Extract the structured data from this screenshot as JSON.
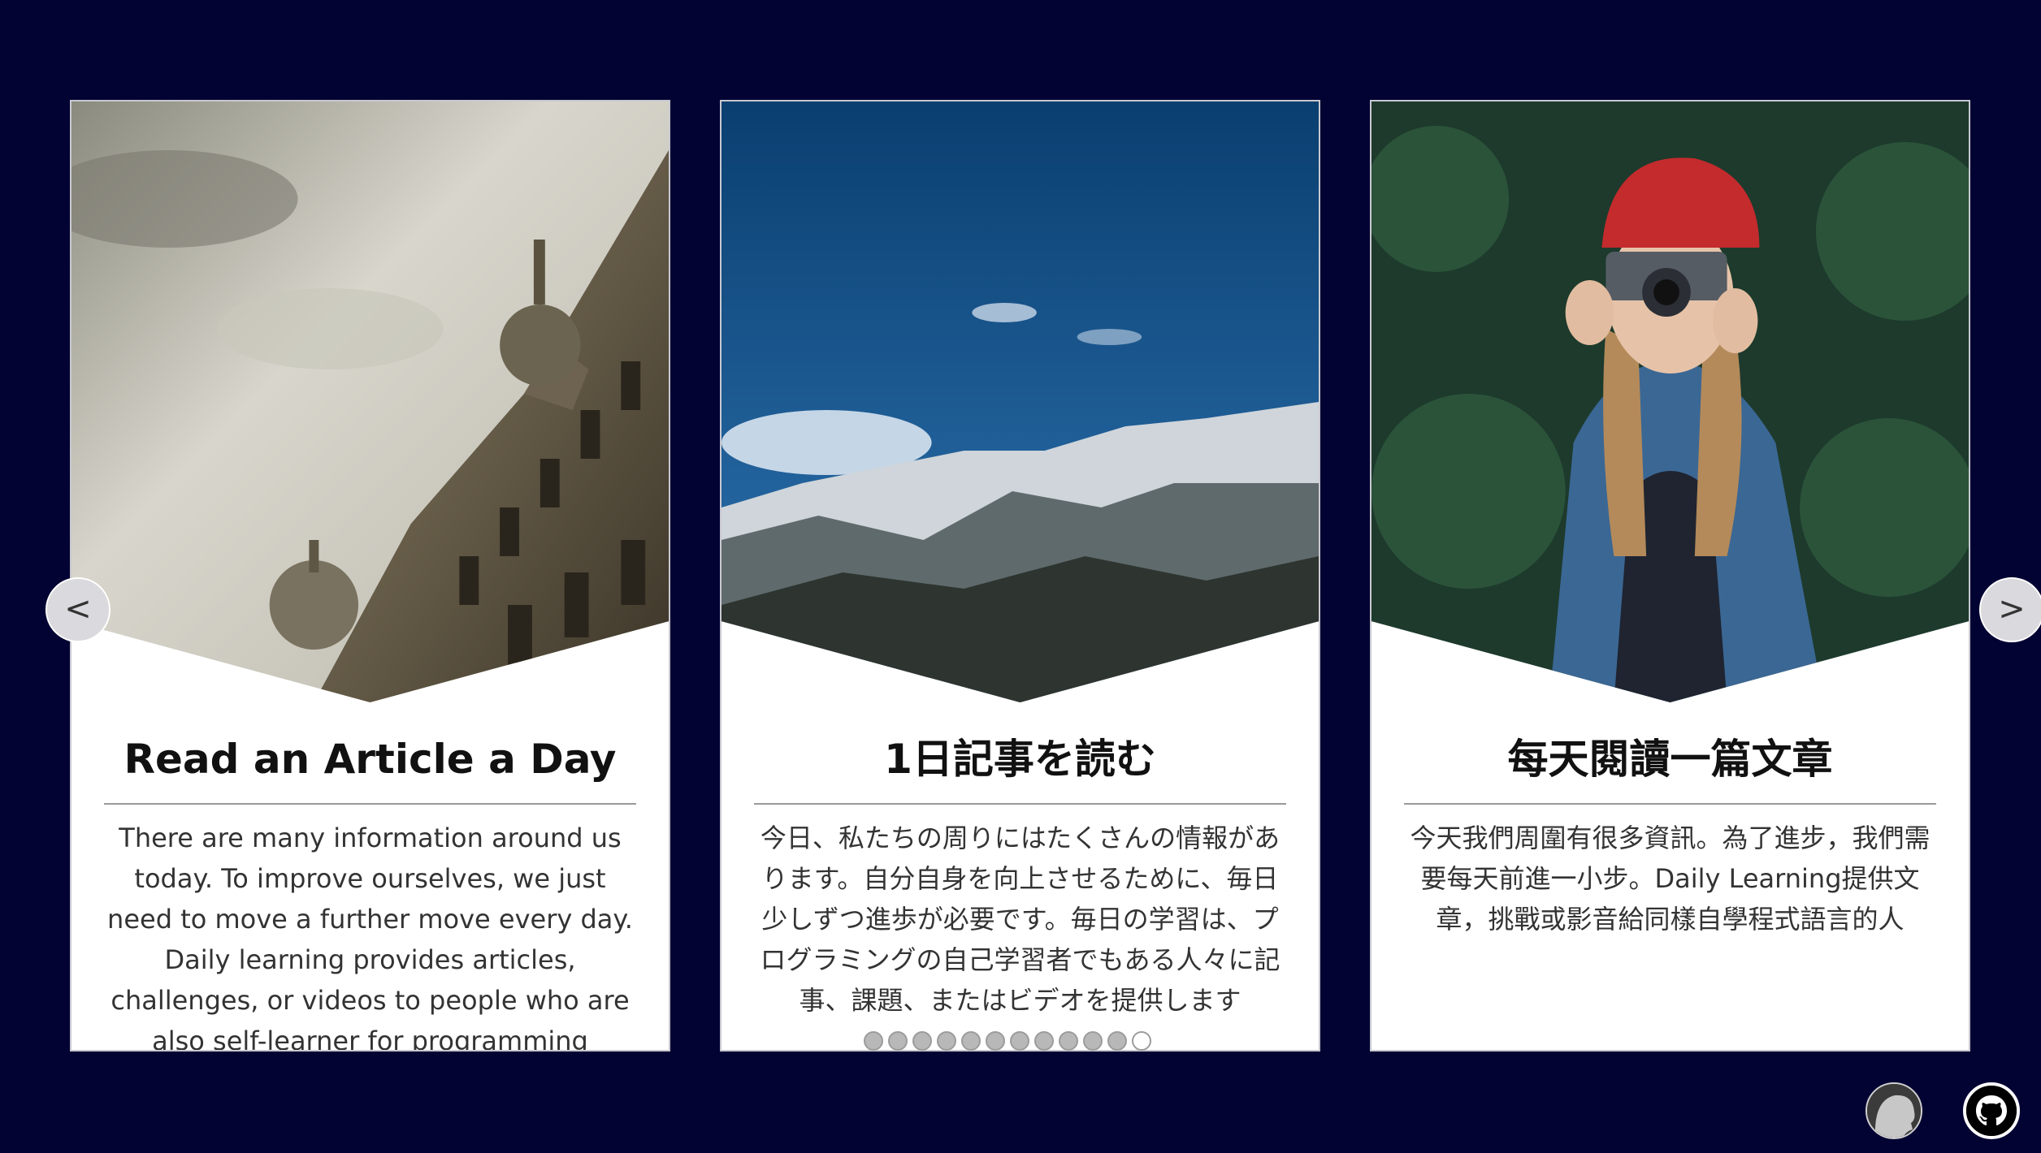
{
  "carousel": {
    "prev_label": "<",
    "next_label": ">",
    "slides": [
      {
        "title": "Read an Article a Day",
        "text": "There are many information around us today. To improve ourselves, we just need to move a further move every day. Daily learning provides articles, challenges, or videos to people who are also self-learner for programming",
        "image": "baroque-building-dome-photo"
      },
      {
        "title": "1日記事を読む",
        "text": "今日、私たちの周りにはたくさんの情報があります。自分自身を向上させるために、毎日少しずつ進歩が必要です。毎日の学習は、プログラミングの自己学習者でもある人々に記事、課題、またはビデオを提供します",
        "image": "snowy-mountains-blue-sky-photo"
      },
      {
        "title": "每天閱讀一篇文章",
        "text": "今天我們周圍有很多資訊。為了進步，我們需要每天前進一小步。Daily Learning提供文章，挑戰或影音給同樣自學程式語言的人",
        "image": "woman-red-beanie-camera-photo"
      }
    ],
    "dot_count": 12,
    "active_dot": 12
  },
  "icons": {
    "profile": "avatar-icon",
    "github": "github-icon"
  },
  "colors": {
    "background": "#020233",
    "card": "#ffffff",
    "divider": "#9a9a9a"
  }
}
